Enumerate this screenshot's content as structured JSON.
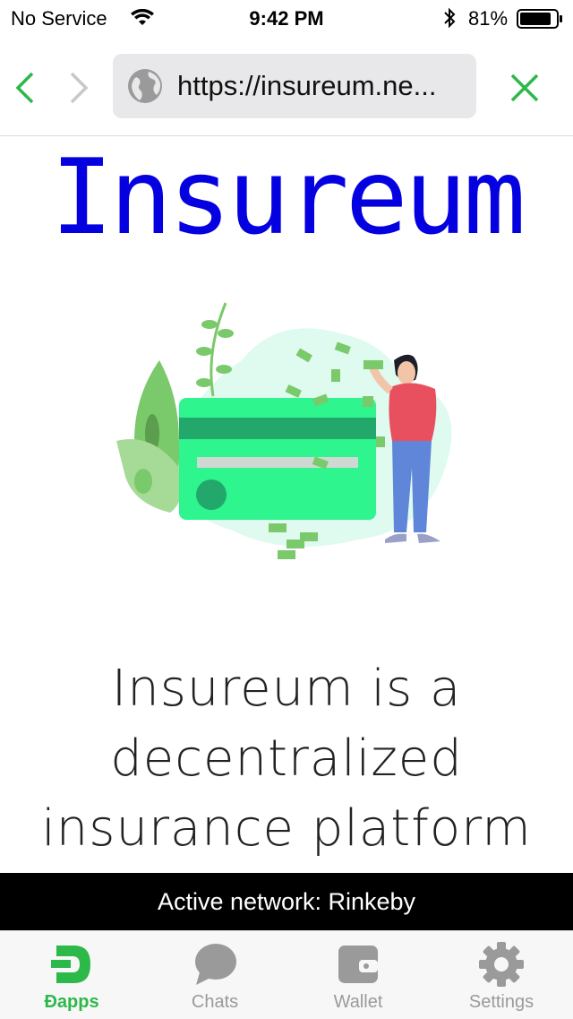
{
  "status_bar": {
    "carrier": "No Service",
    "time": "9:42 PM",
    "battery_percent": "81%"
  },
  "browser": {
    "url": "https://insureum.ne...",
    "icons": [
      "back-icon",
      "forward-icon",
      "globe-icon",
      "close-icon"
    ]
  },
  "page": {
    "title": "Insureum",
    "description_lines": [
      "Insureum is a",
      "decentralized",
      "insurance platform"
    ]
  },
  "network_banner": "Active network: Rinkeby",
  "tabs": [
    {
      "label": "Ðapps",
      "icon": "dapps-icon",
      "active": true
    },
    {
      "label": "Chats",
      "icon": "chat-bubble-icon",
      "active": false
    },
    {
      "label": "Wallet",
      "icon": "wallet-icon",
      "active": false
    },
    {
      "label": "Settings",
      "icon": "gear-icon",
      "active": false
    }
  ],
  "colors": {
    "accent_green": "#2db84a",
    "title_blue": "#0500e0",
    "inactive_gray": "#9a9a9a"
  }
}
